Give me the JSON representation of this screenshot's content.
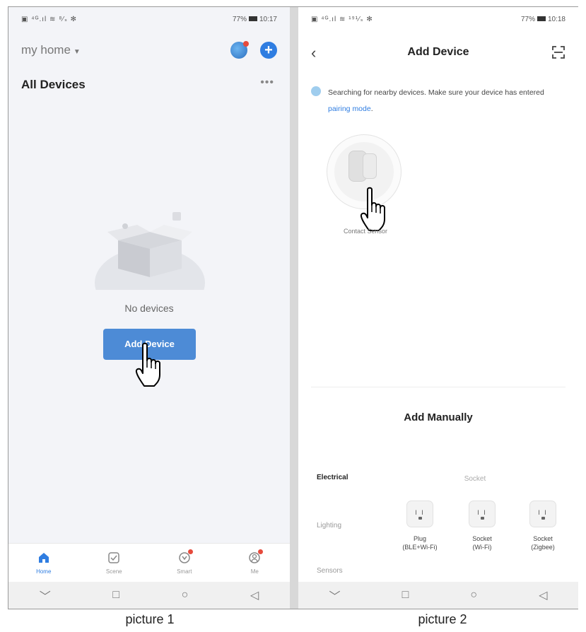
{
  "picture1": {
    "status": {
      "left": "▣ ⁴ᴳ.ıl ≋ ⁸⁄ₛ ✻",
      "battery": "77%",
      "time": "10:17"
    },
    "home_title": "my home",
    "section_title": "All Devices",
    "empty_text": "No devices",
    "add_button": "Add Device",
    "tabs": [
      {
        "label": "Home"
      },
      {
        "label": "Scene"
      },
      {
        "label": "Smart"
      },
      {
        "label": "Me"
      }
    ],
    "caption": "picture 1"
  },
  "picture2": {
    "status": {
      "left": "▣ ⁴ᴳ.ıl ≋ ¹⁹¹⁄ₛ ✻",
      "battery": "77%",
      "time": "10:18"
    },
    "title": "Add Device",
    "search_text": "Searching for nearby devices. Make sure your device has entered ",
    "search_link": "pairing mode",
    "search_end": ".",
    "found_device": "Contact Sensor",
    "manual_title": "Add Manually",
    "categories": [
      "Electrical",
      "Lighting",
      "Sensors"
    ],
    "sub_head": "Socket",
    "products": [
      {
        "name": "Plug",
        "spec": "(BLE+Wi-Fi)"
      },
      {
        "name": "Socket",
        "spec": "(Wi-Fi)"
      },
      {
        "name": "Socket",
        "spec": "(Zigbee)"
      }
    ],
    "caption": "picture 2"
  },
  "colors": {
    "accent": "#2f7de1",
    "button": "#4d8bd6",
    "badge": "#e64a3c"
  }
}
